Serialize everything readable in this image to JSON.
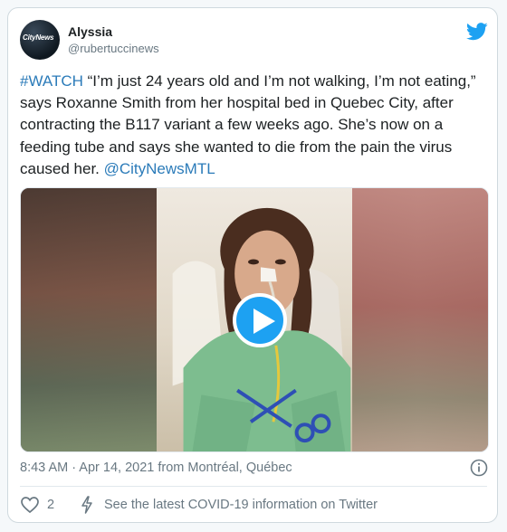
{
  "author": {
    "name": "Alyssia",
    "handle": "@rubertuccinews",
    "avatar_logo": "CityNews"
  },
  "tweet": {
    "hashtag": "#WATCH",
    "body": " “I’m just 24 years old and I’m not walking, I’m not eating,” says Roxanne Smith from her hospital bed in Quebec City, after contracting the B117 variant a few weeks ago. She’s now on a feeding tube and says she wanted to die from the pain the virus caused her. ",
    "mention": "@CityNewsMTL"
  },
  "meta": {
    "timestamp": "8:43 AM · Apr 14, 2021 from Montréal, Québec"
  },
  "actions": {
    "like_count": "2",
    "covid_link": "See the latest COVID-19 information on Twitter"
  },
  "icons": {
    "brand": "twitter-bird-icon",
    "play": "play-icon",
    "info": "info-icon",
    "like": "heart-icon",
    "covid": "lightning-bolt-icon"
  },
  "colors": {
    "accent": "#1da1f2",
    "link": "#2b7bb9",
    "muted": "#697882",
    "text": "#1c2022",
    "border": "#cfd9de"
  }
}
